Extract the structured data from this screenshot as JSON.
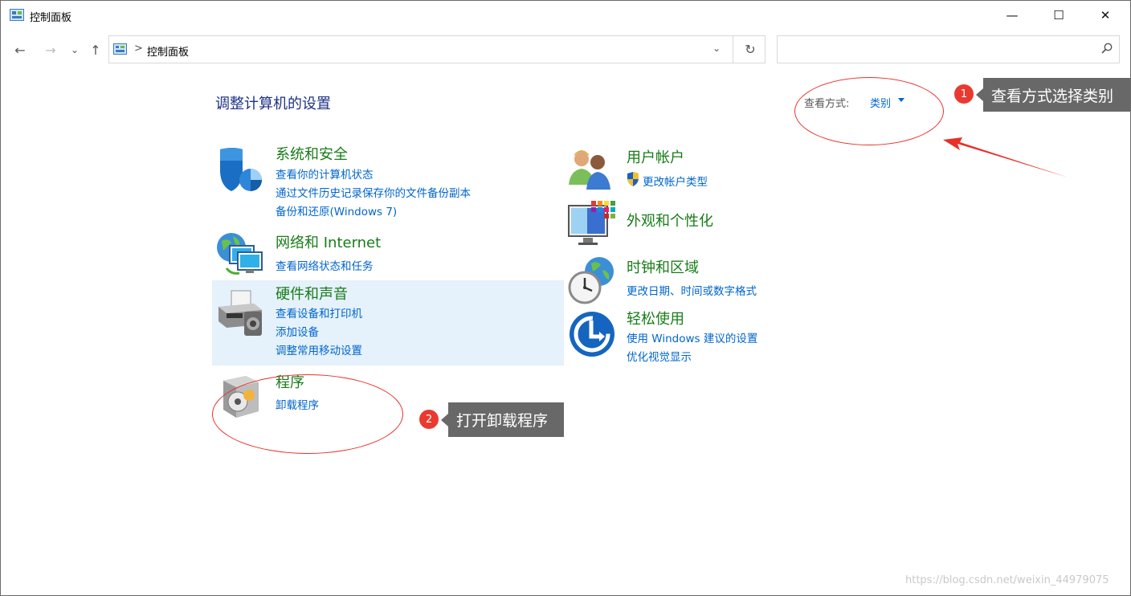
{
  "window": {
    "title": "控制面板",
    "minimize_glyph": "—",
    "maximize_glyph": "☐",
    "close_glyph": "✕"
  },
  "nav": {
    "back_glyph": "←",
    "forward_glyph": "→",
    "recent_glyph": "⌄",
    "up_glyph": "↑"
  },
  "address": {
    "separator": ">",
    "path": "控制面板",
    "dropdown_glyph": "⌄",
    "refresh_glyph": "↻"
  },
  "search": {
    "placeholder": "",
    "icon": "search-icon"
  },
  "main": {
    "title": "调整计算机的设置",
    "view_by_label": "查看方式:",
    "view_by_value": "类别"
  },
  "categories": {
    "system_security": {
      "title": "系统和安全",
      "icon": "shield-icon",
      "links": [
        "查看你的计算机状态",
        "通过文件历史记录保存你的文件备份副本",
        "备份和还原(Windows 7)"
      ]
    },
    "network": {
      "title": "网络和 Internet",
      "icon": "network-globe-icon",
      "links": [
        "查看网络状态和任务"
      ]
    },
    "hardware": {
      "title": "硬件和声音",
      "icon": "printer-icon",
      "links": [
        "查看设备和打印机",
        "添加设备",
        "调整常用移动设置"
      ]
    },
    "programs": {
      "title": "程序",
      "icon": "programs-icon",
      "links": [
        "卸载程序"
      ]
    },
    "user_accounts": {
      "title": "用户帐户",
      "icon": "users-icon",
      "links": [
        "更改帐户类型"
      ]
    },
    "appearance": {
      "title": "外观和个性化",
      "icon": "monitor-icon",
      "links": []
    },
    "clock_region": {
      "title": "时钟和区域",
      "icon": "clock-globe-icon",
      "links": [
        "更改日期、时间或数字格式"
      ]
    },
    "ease_of_access": {
      "title": "轻松使用",
      "icon": "ease-of-access-icon",
      "links": [
        "使用 Windows 建议的设置",
        "优化视觉显示"
      ]
    }
  },
  "annotations": {
    "callout1": {
      "number": "1",
      "text": "查看方式选择类别"
    },
    "callout2": {
      "number": "2",
      "text": "打开卸载程序"
    },
    "accent_color": "#ea3a30",
    "callout_bg": "#686868"
  },
  "watermark": "https://blog.csdn.net/weixin_44979075"
}
